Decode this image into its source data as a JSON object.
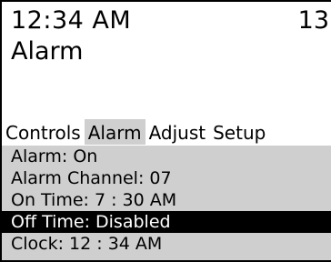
{
  "status": {
    "time": "12:34 AM",
    "corner_value": "13"
  },
  "screen_title": "Alarm",
  "tabs": [
    {
      "label": "Controls",
      "active": false
    },
    {
      "label": "Alarm",
      "active": true
    },
    {
      "label": "Adjust",
      "active": false
    },
    {
      "label": "Setup",
      "active": false
    }
  ],
  "menu_items": [
    {
      "label": "Alarm: On",
      "selected": false
    },
    {
      "label": "Alarm Channel:  07",
      "selected": false
    },
    {
      "label": "On Time:   7 : 30 AM",
      "selected": false
    },
    {
      "label": "Off Time:  Disabled",
      "selected": true
    },
    {
      "label": "Clock:   12 : 34 AM",
      "selected": false
    }
  ],
  "colors": {
    "background": "#ffffff",
    "menu_background": "#cfcfcf",
    "active_tab": "#cfcfcf",
    "selection": "#000000",
    "text": "#000000",
    "selected_text": "#ffffff"
  }
}
